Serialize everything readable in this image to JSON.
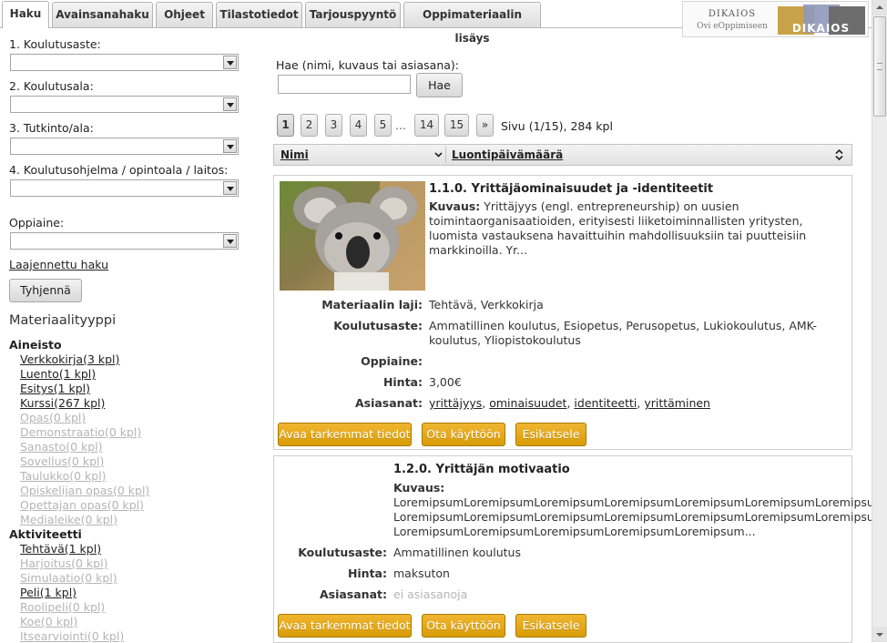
{
  "tabs": [
    {
      "label": "Haku",
      "active": true
    },
    {
      "label": "Avainsanahaku",
      "active": false
    },
    {
      "label": "Ohjeet",
      "active": false
    },
    {
      "label": "Tilastotiedot",
      "active": false
    },
    {
      "label": "Tarjouspyyntö",
      "active": false
    },
    {
      "label": "Oppimateriaalin lisäys",
      "active": false
    }
  ],
  "logo": {
    "line1": "DIKAIOS",
    "line2": "Ovi eOppimiseen",
    "wordmark": "DIKAIOS",
    "colors": {
      "gold": "#c9a34a",
      "blue": "#8f98bd",
      "gray": "#6d6d6d"
    }
  },
  "filters": {
    "koulutusaste": {
      "label": "1. Koulutusaste:",
      "value": ""
    },
    "koulutusala": {
      "label": "2. Koulutusala:",
      "value": ""
    },
    "tutkinto": {
      "label": "3. Tutkinto/ala:",
      "value": ""
    },
    "ohjelma": {
      "label": "4. Koulutusohjelma / opintoala / laitos:",
      "value": ""
    },
    "oppiaine": {
      "label": "Oppiaine:",
      "value": ""
    },
    "advanced_link": "Laajennettu haku",
    "clear_button": "Tyhjennä"
  },
  "materialtypes": {
    "heading": "Materiaalityyppi",
    "aineisto": {
      "heading": "Aineisto",
      "items": [
        {
          "label": "Verkkokirja(3 kpl)",
          "enabled": true
        },
        {
          "label": "Luento(1 kpl)",
          "enabled": true
        },
        {
          "label": "Esitys(1 kpl)",
          "enabled": true
        },
        {
          "label": "Kurssi(267 kpl)",
          "enabled": true
        },
        {
          "label": "Opas(0 kpl)",
          "enabled": false
        },
        {
          "label": "Demonstraatio(0 kpl)",
          "enabled": false
        },
        {
          "label": "Sanasto(0 kpl)",
          "enabled": false
        },
        {
          "label": "Sovellus(0 kpl)",
          "enabled": false
        },
        {
          "label": "Taulukko(0 kpl)",
          "enabled": false
        },
        {
          "label": "Opiskelijan opas(0 kpl)",
          "enabled": false
        },
        {
          "label": "Opettajan opas(0 kpl)",
          "enabled": false
        },
        {
          "label": "Medialeike(0 kpl)",
          "enabled": false
        }
      ]
    },
    "aktiviteetti": {
      "heading": "Aktiviteetti",
      "items": [
        {
          "label": "Tehtävä(1 kpl)",
          "enabled": true
        },
        {
          "label": "Harjoitus(0 kpl)",
          "enabled": false
        },
        {
          "label": "Simulaatio(0 kpl)",
          "enabled": false
        },
        {
          "label": "Peli(1 kpl)",
          "enabled": true
        },
        {
          "label": "Roolipeli(0 kpl)",
          "enabled": false
        },
        {
          "label": "Koe(0 kpl)",
          "enabled": false
        },
        {
          "label": "Itsearviointi(0 kpl)",
          "enabled": false
        }
      ]
    }
  },
  "search": {
    "label": "Hae (nimi, kuvaus tai asiasana):",
    "value": "",
    "button": "Hae"
  },
  "pager": {
    "pages": [
      "1",
      "2",
      "3",
      "4",
      "5"
    ],
    "ellipsis": "...",
    "tail": [
      "14",
      "15"
    ],
    "next": "»",
    "current": "1",
    "info": "Sivu (1/15), 284 kpl"
  },
  "sort": {
    "col1": "Nimi",
    "col2": "Luontipäivämäärä"
  },
  "results": [
    {
      "title": "1.1.0. Yrittäjäominaisuudet ja -identiteetit",
      "desc_label": "Kuvaus:",
      "desc": "Yrittäjyys (engl. entrepreneurship) on uusien toimintaorganisaatioiden, erityisesti liiketoiminnallisten yritysten, luomista vastauksena havaittuihin mahdollisuuksiin tai puutteisiin markkinoilla. Yr...",
      "meta": {
        "laji_key": "Materiaalin laji:",
        "laji": "Tehtävä, Verkkokirja",
        "aste_key": "Koulutusaste:",
        "aste": "Ammatillinen koulutus, Esiopetus, Perusopetus, Lukiokoulutus, AMK-koulutus, Yliopistokoulutus",
        "oppiaine_key": "Oppiaine:",
        "oppiaine": "",
        "hinta_key": "Hinta:",
        "hinta": "3,00€",
        "asiasanat_key": "Asiasanat:",
        "tags": [
          "yrittäjyys",
          "ominaisuudet",
          "identiteetti",
          "yrittäminen"
        ]
      },
      "buttons": [
        "Avaa tarkemmat tiedot",
        "Ota käyttöön",
        "Esikatsele"
      ]
    },
    {
      "title": "1.2.0. Yrittäjän motivaatio",
      "desc_label": "Kuvaus:",
      "desc_lines": [
        "LoremipsumLoremipsumLoremipsumLoremipsumLoremipsumLoremipsumLoremipsum",
        "LoremipsumLoremipsumLoremipsumLoremipsumLoremipsumLoremipsumLoremipsum",
        "LoremipsumLoremipsumLoremipsumLoremipsumLoremipsum..."
      ],
      "meta": {
        "aste_key": "Koulutusaste:",
        "aste": "Ammatillinen koulutus",
        "hinta_key": "Hinta:",
        "hinta": "maksuton",
        "asiasanat_key": "Asiasanat:",
        "asiasanat": "ei asiasanoja"
      },
      "buttons": [
        "Avaa tarkemmat tiedot",
        "Ota käyttöön",
        "Esikatsele"
      ]
    }
  ],
  "colors": {
    "button_gold": "#e0a414",
    "muted_text": "#b5b5b5"
  }
}
